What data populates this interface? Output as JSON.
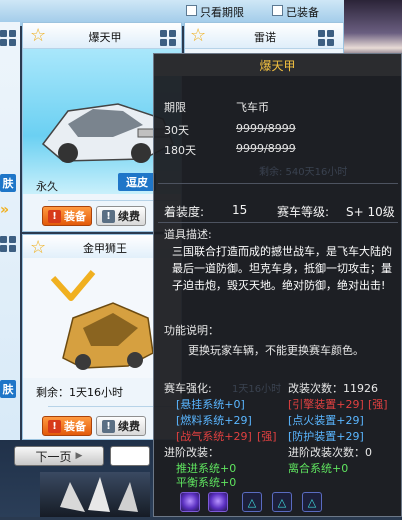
{
  "filters": {
    "only_limited": "只看期限",
    "equipped": "已装备"
  },
  "cards": {
    "top_left": {
      "name": "爆天甲",
      "duration": "永久",
      "tag": "逗皮",
      "equip_label": "装备",
      "renew_label": "续费"
    },
    "top_right": {
      "name": "雷诺"
    },
    "bottom_left": {
      "name": "金甲狮王",
      "remaining": "剩余：1天16小时",
      "equip_label": "装备",
      "renew_label": "续费"
    },
    "left_edge_tags": [
      "肤",
      "肤"
    ]
  },
  "pager": {
    "prev_label": "下一页"
  },
  "tooltip": {
    "title": "爆天甲",
    "price_header": {
      "period": "期限",
      "currency": "飞车币"
    },
    "price_rows": [
      {
        "period": "30天",
        "price": "9999/8999"
      },
      {
        "period": "180天",
        "price": "9999/8999"
      }
    ],
    "equip_level_label": "着装度:",
    "equip_level_value": "15",
    "car_level_label": "赛车等级:",
    "car_level_value": "S+ 10级",
    "desc_label": "道具描述:",
    "desc_text": "三国联合打造而成的撼世战车，是飞车大陆的最后一道防御。坦克车身，抵御一切攻击；量子迫击炮，毁灭天地。绝对防御，绝对出击!",
    "func_label": "功能说明：",
    "func_text": "更换玩家车辆，不能更换赛车颜色。",
    "enhance_label": "赛车强化:",
    "modify_count_label": "改装次数：11926",
    "enhance_left": [
      "[悬挂系统+0]",
      "[燃料系统+29]",
      "[战气系统+29]"
    ],
    "enhance_left_tail": "[强]",
    "enhance_right": [
      "[引擎装置+29]",
      "[点火装置+29]",
      "[防护装置+29]"
    ],
    "enhance_right_tail": "[强]",
    "advanced_label": "进阶改装：",
    "advanced_count_label": "进阶改装次数：0",
    "advanced_items": [
      "推进系统+0",
      "离合系统+0",
      "平衡系统+0"
    ],
    "ghost_text": "剩余: 540天16小时",
    "ghost_text_2": "1天16小时",
    "colors": {
      "title": "#f2c040",
      "enhance_blue": "#5ab6ff",
      "advanced_green": "#5fe45f",
      "strong_red": "#e04040"
    }
  }
}
